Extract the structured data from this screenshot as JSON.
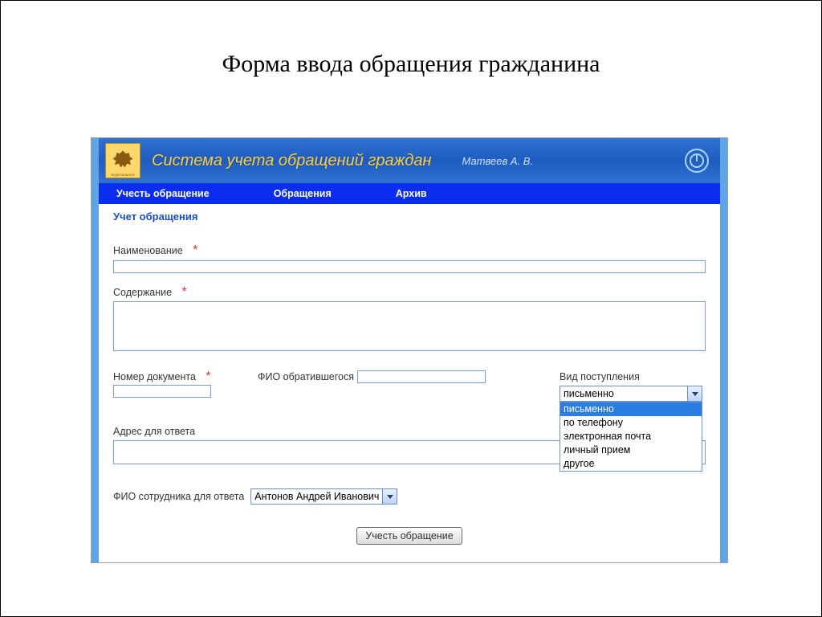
{
  "slide": {
    "title": "Форма ввода обращения гражданина"
  },
  "header": {
    "system_title": "Система учета обращений граждан",
    "user": "Матвеев А. В.",
    "emblem_caption": "ФЕДЕРАЛЬНОЕ"
  },
  "nav": {
    "items": [
      "Учесть обращение",
      "Обращения",
      "Архив"
    ]
  },
  "form": {
    "section_title": "Учет обращения",
    "labels": {
      "name": "Наименование",
      "content": "Содержание",
      "doc_number": "Номер документа",
      "applicant_fio": "ФИО обратившегося",
      "receipt_type": "Вид поступления",
      "reply_address": "Адрес для ответа",
      "staff_fio": "ФИО сотрудника для ответа"
    },
    "values": {
      "name": "",
      "content": "",
      "doc_number": "",
      "applicant_fio": "",
      "reply_address": "",
      "receipt_type_selected": "письменно",
      "staff_selected": "Антонов Андрей Иванович"
    },
    "receipt_type_options": [
      "письменно",
      "по телефону",
      "электронная почта",
      "личный прием",
      "другое"
    ],
    "submit_label": "Учесть обращение"
  }
}
